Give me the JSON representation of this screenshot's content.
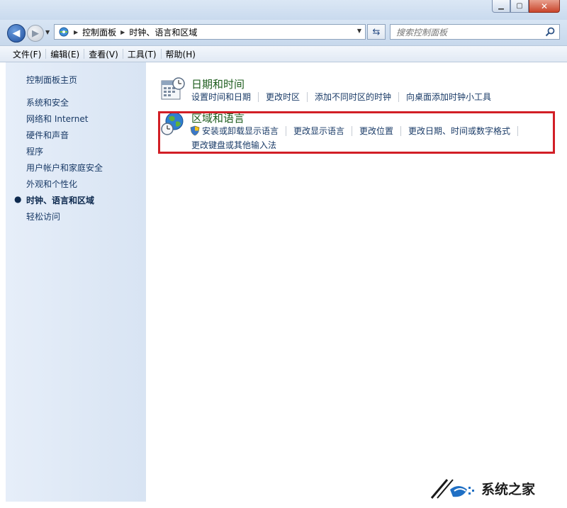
{
  "window": {
    "controls": {
      "minimize_icon": "minimize-icon",
      "maximize_icon": "maximize-icon",
      "close_icon": "close-icon"
    }
  },
  "nav": {
    "breadcrumb": [
      "控制面板",
      "时钟、语言和区域"
    ],
    "search_placeholder": "搜索控制面板"
  },
  "menubar": {
    "items": [
      "文件(F)",
      "编辑(E)",
      "查看(V)",
      "工具(T)",
      "帮助(H)"
    ]
  },
  "sidebar": {
    "home": "控制面板主页",
    "items": [
      "系统和安全",
      "网络和 Internet",
      "硬件和声音",
      "程序",
      "用户帐户和家庭安全",
      "外观和个性化",
      "时钟、语言和区域",
      "轻松访问"
    ],
    "current": "时钟、语言和区域"
  },
  "categories": [
    {
      "title": "日期和时间",
      "icon": "calendar-clock-icon",
      "tasks": [
        "设置时间和日期",
        "更改时区",
        "添加不同时区的时钟",
        "向桌面添加时钟小工具"
      ]
    },
    {
      "title": "区域和语言",
      "icon": "globe-clock-icon",
      "tasks": [
        "安装或卸载显示语言",
        "更改显示语言",
        "更改位置",
        "更改日期、时间或数字格式"
      ],
      "tasks_line2": [
        "更改键盘或其他输入法"
      ]
    }
  ],
  "colors": {
    "highlight": "#d21f26",
    "link": "#1a3b67",
    "category_title": "#1e5d1e"
  },
  "watermark": {
    "text": "系统之家"
  }
}
